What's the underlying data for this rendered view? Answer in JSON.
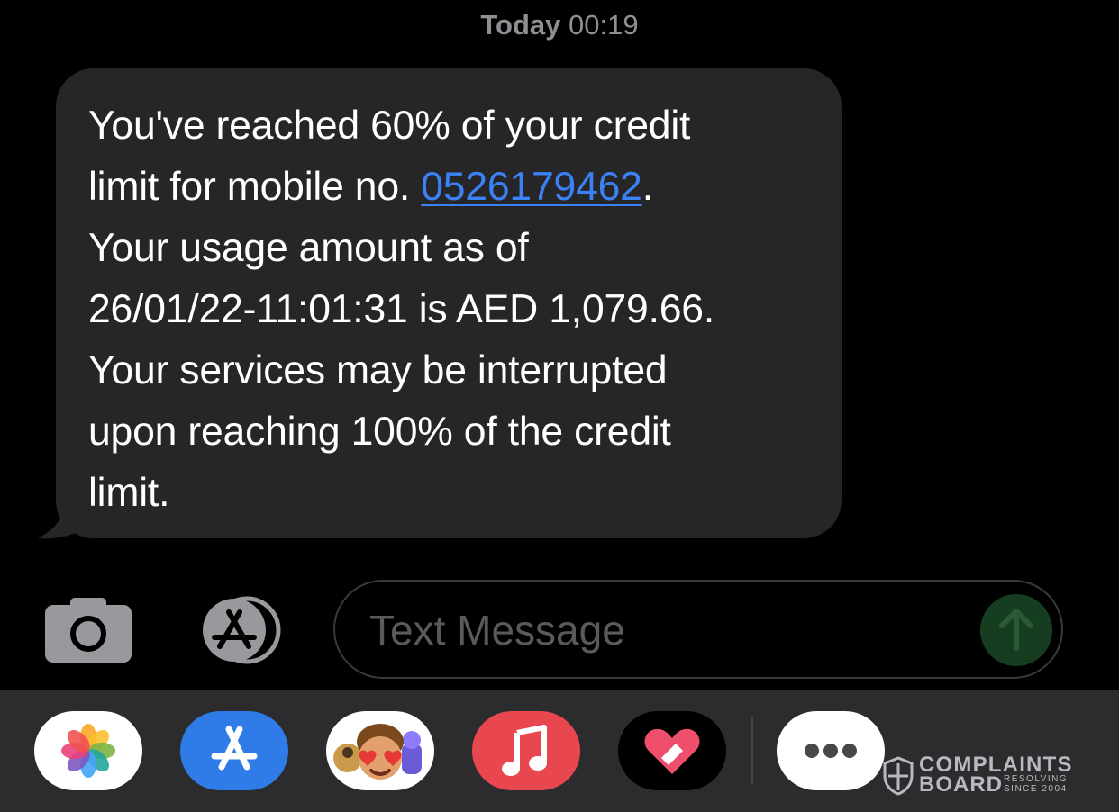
{
  "header": {
    "day": "Today",
    "time": "00:19"
  },
  "message": {
    "line1": "You've reached 60% of your credit",
    "line2_prefix": "limit for mobile no. ",
    "phone": "0526179462",
    "line2_suffix": ".",
    "line3": "Your usage amount as of",
    "line4": "26/01/22-11:01:31 is AED 1,079.66.",
    "line5": "Your services may be interrupted",
    "line6": "upon reaching 100% of the credit",
    "line7": "limit."
  },
  "composer": {
    "placeholder": "Text Message"
  },
  "apps": [
    {
      "icon": "photos-icon"
    },
    {
      "icon": "app-store-icon"
    },
    {
      "icon": "memoji-icon"
    },
    {
      "icon": "music-icon"
    },
    {
      "icon": "digital-touch-icon"
    },
    {
      "icon": "more-apps-icon"
    }
  ],
  "watermark": {
    "line1": "COMPLAINTS",
    "line2": "BOARD",
    "tag1": "RESOLVING",
    "tag2": "SINCE 2004"
  },
  "colors": {
    "background": "#000000",
    "bubble": "#262628",
    "link": "#3b82f6",
    "drawer": "#2c2c2e",
    "send": "#173d20"
  }
}
